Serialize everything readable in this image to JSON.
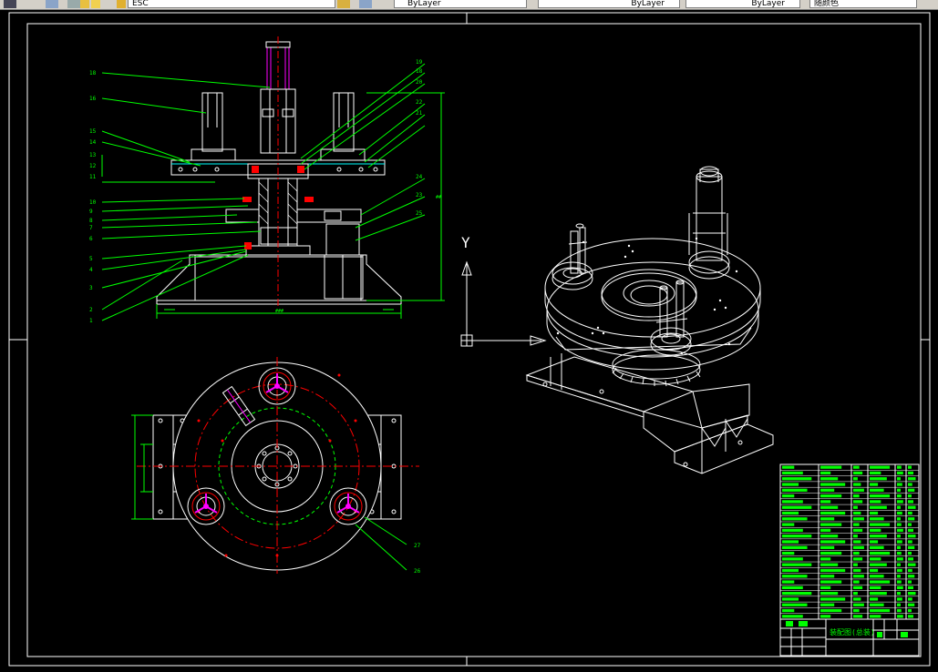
{
  "toolbar": {
    "layer_name": "ESC",
    "color_value": "ByLayer",
    "linetype_value": "ByLayer",
    "lineweight_value": "ByLayer",
    "plotstyle_value": "随颜色"
  },
  "drawing": {
    "axis_y_label": "Y",
    "part_numbers_left": [
      "18",
      "16",
      "15",
      "14",
      "13",
      "12",
      "11",
      "10",
      "9",
      "8",
      "7",
      "6",
      "5",
      "4",
      "3",
      "2",
      "1"
    ],
    "part_numbers_right": [
      "19",
      "18",
      "20",
      "22",
      "21",
      "24",
      "23",
      "25"
    ],
    "callout_top_view": [
      "27",
      "26"
    ],
    "title_block_title": "装配图(总装)"
  },
  "colors": {
    "background": "#000000",
    "lines": "#ffffff",
    "dimension": "#00ff00",
    "centerline": "#ff0000",
    "hidden": "#ff00ff",
    "axis": "#ffffff"
  }
}
